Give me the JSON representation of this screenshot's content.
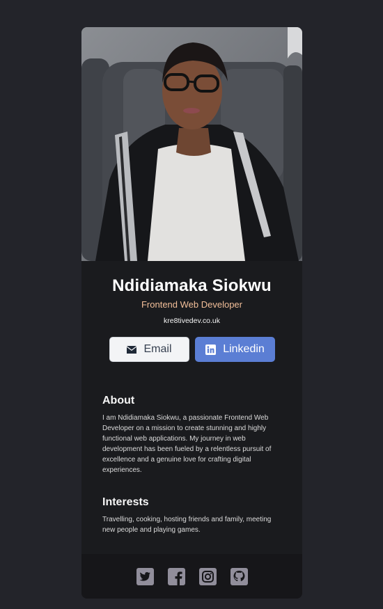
{
  "profile": {
    "name": "Ndidiamaka Siokwu",
    "role": "Frontend Web Developer",
    "website": "kre8tivedev.co.uk"
  },
  "buttons": {
    "email_label": "Email",
    "linkedin_label": "Linkedin",
    "email_icon": "envelope-icon",
    "linkedin_icon": "linkedin-icon"
  },
  "about": {
    "title": "About",
    "text": "I am Ndidiamaka Siokwu, a passionate Frontend Web Developer on a mission to create stunning and highly functional web applications. My journey in web development has been fueled by a relentless pursuit of excellence and a genuine love for crafting digital experiences."
  },
  "interests": {
    "title": "Interests",
    "text": "Travelling, cooking, hosting friends and family, meeting new people and playing games."
  },
  "footer": {
    "icons": [
      "twitter-icon",
      "facebook-icon",
      "instagram-icon",
      "github-icon"
    ]
  },
  "colors": {
    "page_bg": "#23242a",
    "card_bg": "#1a1b1e",
    "footer_bg": "#161619",
    "role_accent": "#f3bf99",
    "linkedin_button": "#5b7ed4",
    "social_icon": "#918e9b"
  }
}
